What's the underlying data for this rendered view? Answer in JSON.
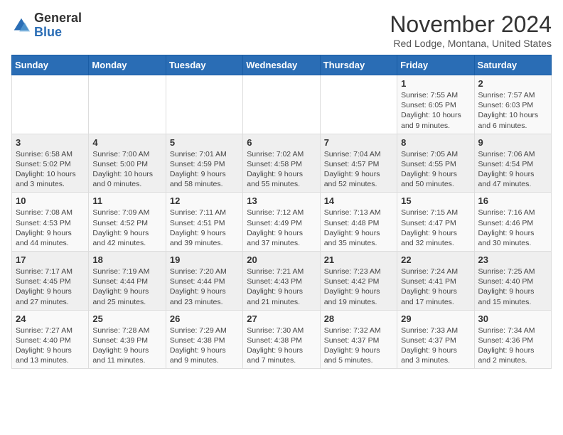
{
  "logo": {
    "general": "General",
    "blue": "Blue"
  },
  "header": {
    "month": "November 2024",
    "location": "Red Lodge, Montana, United States"
  },
  "days_of_week": [
    "Sunday",
    "Monday",
    "Tuesday",
    "Wednesday",
    "Thursday",
    "Friday",
    "Saturday"
  ],
  "weeks": [
    [
      {
        "day": "",
        "info": ""
      },
      {
        "day": "",
        "info": ""
      },
      {
        "day": "",
        "info": ""
      },
      {
        "day": "",
        "info": ""
      },
      {
        "day": "",
        "info": ""
      },
      {
        "day": "1",
        "info": "Sunrise: 7:55 AM\nSunset: 6:05 PM\nDaylight: 10 hours and 9 minutes."
      },
      {
        "day": "2",
        "info": "Sunrise: 7:57 AM\nSunset: 6:03 PM\nDaylight: 10 hours and 6 minutes."
      }
    ],
    [
      {
        "day": "3",
        "info": "Sunrise: 6:58 AM\nSunset: 5:02 PM\nDaylight: 10 hours and 3 minutes."
      },
      {
        "day": "4",
        "info": "Sunrise: 7:00 AM\nSunset: 5:00 PM\nDaylight: 10 hours and 0 minutes."
      },
      {
        "day": "5",
        "info": "Sunrise: 7:01 AM\nSunset: 4:59 PM\nDaylight: 9 hours and 58 minutes."
      },
      {
        "day": "6",
        "info": "Sunrise: 7:02 AM\nSunset: 4:58 PM\nDaylight: 9 hours and 55 minutes."
      },
      {
        "day": "7",
        "info": "Sunrise: 7:04 AM\nSunset: 4:57 PM\nDaylight: 9 hours and 52 minutes."
      },
      {
        "day": "8",
        "info": "Sunrise: 7:05 AM\nSunset: 4:55 PM\nDaylight: 9 hours and 50 minutes."
      },
      {
        "day": "9",
        "info": "Sunrise: 7:06 AM\nSunset: 4:54 PM\nDaylight: 9 hours and 47 minutes."
      }
    ],
    [
      {
        "day": "10",
        "info": "Sunrise: 7:08 AM\nSunset: 4:53 PM\nDaylight: 9 hours and 44 minutes."
      },
      {
        "day": "11",
        "info": "Sunrise: 7:09 AM\nSunset: 4:52 PM\nDaylight: 9 hours and 42 minutes."
      },
      {
        "day": "12",
        "info": "Sunrise: 7:11 AM\nSunset: 4:51 PM\nDaylight: 9 hours and 39 minutes."
      },
      {
        "day": "13",
        "info": "Sunrise: 7:12 AM\nSunset: 4:49 PM\nDaylight: 9 hours and 37 minutes."
      },
      {
        "day": "14",
        "info": "Sunrise: 7:13 AM\nSunset: 4:48 PM\nDaylight: 9 hours and 35 minutes."
      },
      {
        "day": "15",
        "info": "Sunrise: 7:15 AM\nSunset: 4:47 PM\nDaylight: 9 hours and 32 minutes."
      },
      {
        "day": "16",
        "info": "Sunrise: 7:16 AM\nSunset: 4:46 PM\nDaylight: 9 hours and 30 minutes."
      }
    ],
    [
      {
        "day": "17",
        "info": "Sunrise: 7:17 AM\nSunset: 4:45 PM\nDaylight: 9 hours and 27 minutes."
      },
      {
        "day": "18",
        "info": "Sunrise: 7:19 AM\nSunset: 4:44 PM\nDaylight: 9 hours and 25 minutes."
      },
      {
        "day": "19",
        "info": "Sunrise: 7:20 AM\nSunset: 4:44 PM\nDaylight: 9 hours and 23 minutes."
      },
      {
        "day": "20",
        "info": "Sunrise: 7:21 AM\nSunset: 4:43 PM\nDaylight: 9 hours and 21 minutes."
      },
      {
        "day": "21",
        "info": "Sunrise: 7:23 AM\nSunset: 4:42 PM\nDaylight: 9 hours and 19 minutes."
      },
      {
        "day": "22",
        "info": "Sunrise: 7:24 AM\nSunset: 4:41 PM\nDaylight: 9 hours and 17 minutes."
      },
      {
        "day": "23",
        "info": "Sunrise: 7:25 AM\nSunset: 4:40 PM\nDaylight: 9 hours and 15 minutes."
      }
    ],
    [
      {
        "day": "24",
        "info": "Sunrise: 7:27 AM\nSunset: 4:40 PM\nDaylight: 9 hours and 13 minutes."
      },
      {
        "day": "25",
        "info": "Sunrise: 7:28 AM\nSunset: 4:39 PM\nDaylight: 9 hours and 11 minutes."
      },
      {
        "day": "26",
        "info": "Sunrise: 7:29 AM\nSunset: 4:38 PM\nDaylight: 9 hours and 9 minutes."
      },
      {
        "day": "27",
        "info": "Sunrise: 7:30 AM\nSunset: 4:38 PM\nDaylight: 9 hours and 7 minutes."
      },
      {
        "day": "28",
        "info": "Sunrise: 7:32 AM\nSunset: 4:37 PM\nDaylight: 9 hours and 5 minutes."
      },
      {
        "day": "29",
        "info": "Sunrise: 7:33 AM\nSunset: 4:37 PM\nDaylight: 9 hours and 3 minutes."
      },
      {
        "day": "30",
        "info": "Sunrise: 7:34 AM\nSunset: 4:36 PM\nDaylight: 9 hours and 2 minutes."
      }
    ]
  ]
}
